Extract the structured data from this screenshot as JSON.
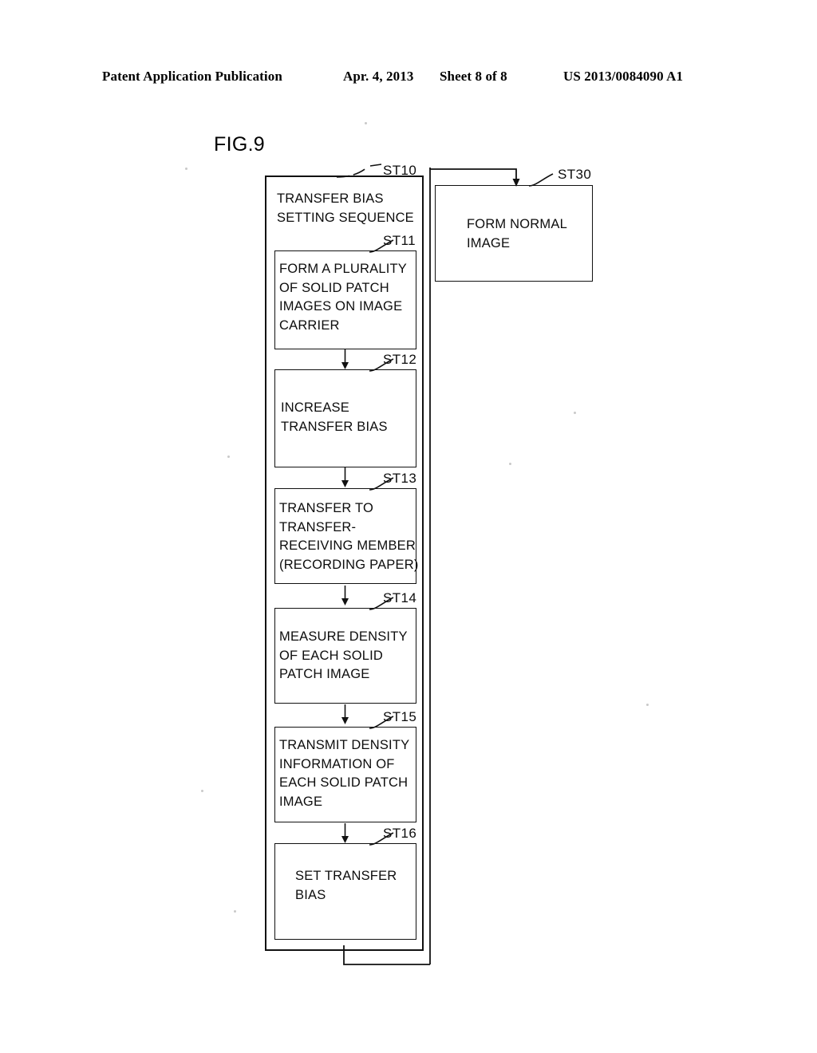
{
  "header": {
    "publication": "Patent Application Publication",
    "date": "Apr. 4, 2013",
    "sheet": "Sheet 8 of 8",
    "patent_number": "US 2013/0084090 A1"
  },
  "figure": {
    "label": "FIG.9",
    "type": "flowchart"
  },
  "flowchart": {
    "outer_process": {
      "tag": "ST10",
      "text": "TRANSFER BIAS\nSETTING SEQUENCE"
    },
    "steps": [
      {
        "tag": "ST11",
        "text": "FORM A PLURALITY\nOF SOLID PATCH\nIMAGES ON IMAGE\nCARRIER"
      },
      {
        "tag": "ST12",
        "text": "INCREASE\nTRANSFER BIAS"
      },
      {
        "tag": "ST13",
        "text": "TRANSFER TO\nTRANSFER-\nRECEIVING MEMBER\n(RECORDING PAPER)"
      },
      {
        "tag": "ST14",
        "text": "MEASURE DENSITY\nOF EACH SOLID\nPATCH IMAGE"
      },
      {
        "tag": "ST15",
        "text": "TRANSMIT DENSITY\nINFORMATION OF\nEACH SOLID PATCH\nIMAGE"
      },
      {
        "tag": "ST16",
        "text": "SET TRANSFER\nBIAS"
      }
    ],
    "terminal_step": {
      "tag": "ST30",
      "text": "FORM NORMAL\nIMAGE"
    }
  },
  "colors": {
    "ink": "#111111",
    "paper": "#ffffff"
  }
}
